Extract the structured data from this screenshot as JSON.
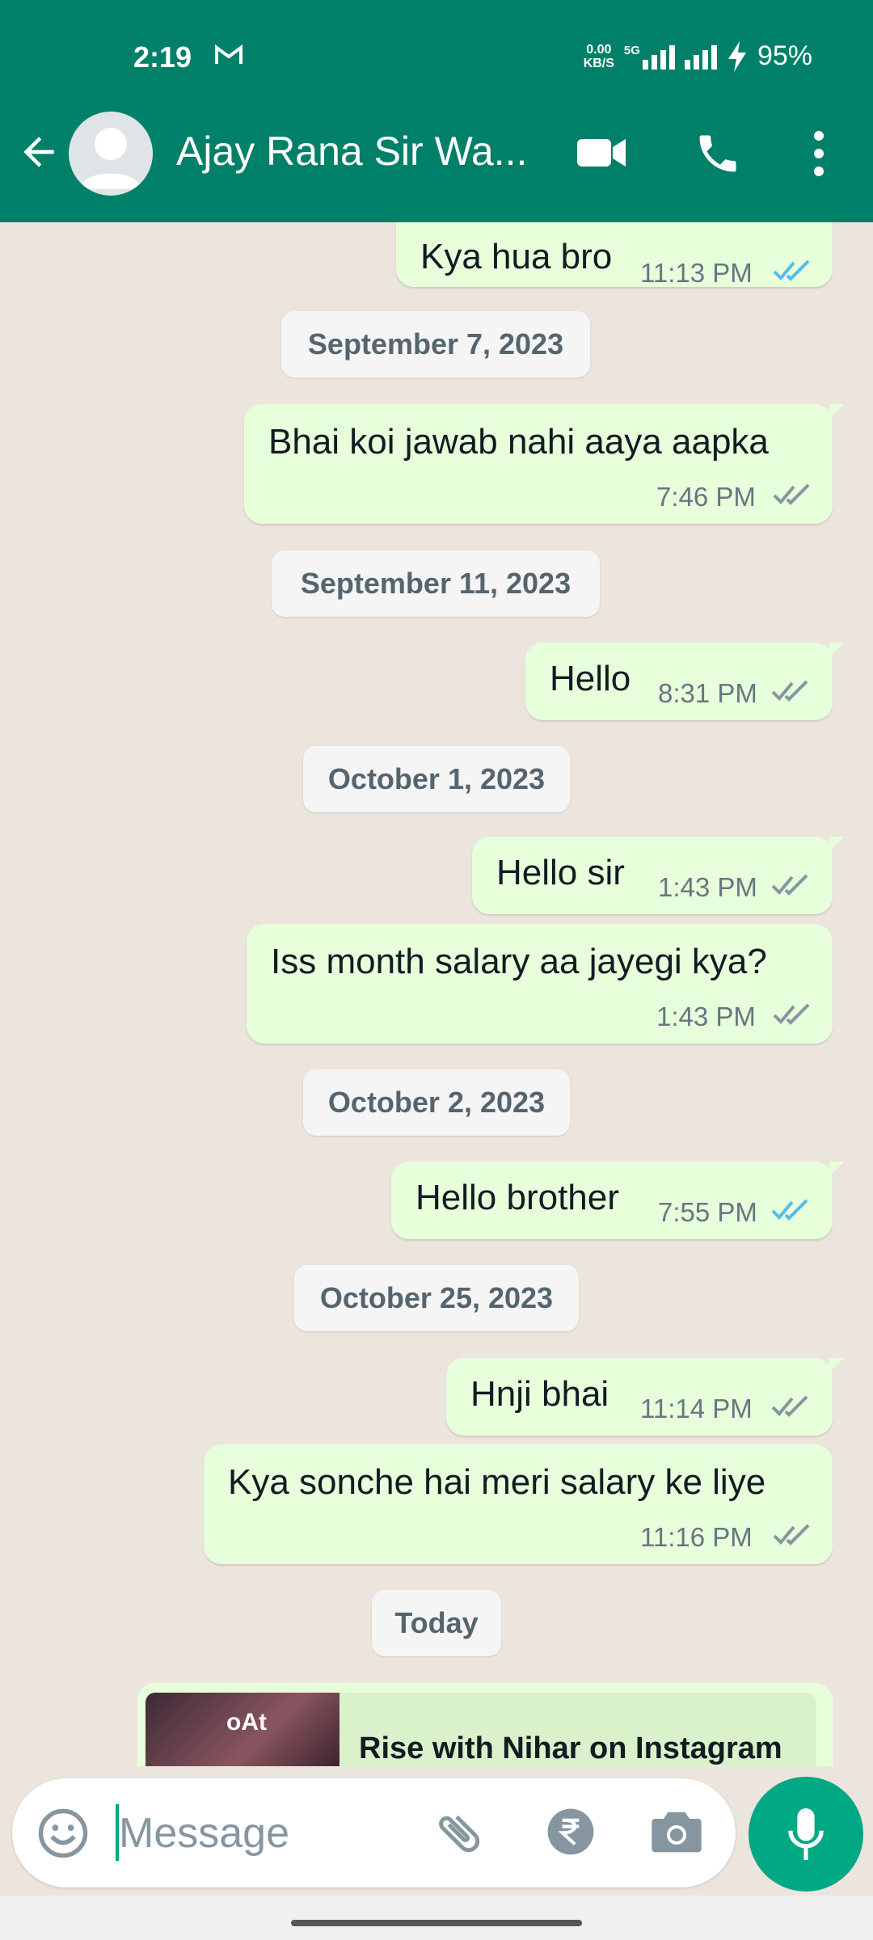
{
  "status_bar": {
    "time": "2:19",
    "net_speed_top": "0.00",
    "net_speed_bottom": "KB/S",
    "network": "5G",
    "battery": "95%"
  },
  "header": {
    "contact_name": "Ajay Rana Sir Wa...",
    "icons": [
      "back-arrow-icon",
      "avatar",
      "video-call-icon",
      "voice-call-icon",
      "more-vert-icon"
    ]
  },
  "messages": [
    {
      "text": "Kya hua bro",
      "time": "11:13 PM",
      "read": true
    },
    {
      "date": "September 7, 2023"
    },
    {
      "text": "Bhai koi jawab nahi aaya aapka",
      "time": "7:46 PM",
      "read": false
    },
    {
      "date": "September 11, 2023"
    },
    {
      "text": "Hello",
      "time": "8:31 PM",
      "read": false
    },
    {
      "date": "October 1, 2023"
    },
    {
      "text": "Hello sir",
      "time": "1:43 PM",
      "read": false
    },
    {
      "text": "Iss month salary aa jayegi kya?",
      "time": "1:43 PM",
      "read": false
    },
    {
      "date": "October 2, 2023"
    },
    {
      "text": "Hello brother",
      "time": "7:55 PM",
      "read": true
    },
    {
      "date": "October 25, 2023"
    },
    {
      "text": "Hnji bhai",
      "time": "11:14 PM",
      "read": false
    },
    {
      "text": "Kya sonche hai meri salary ke liye",
      "time": "11:16 PM",
      "read": false
    },
    {
      "date": "Today"
    }
  ],
  "link_preview": {
    "title": "Rise with Nihar on Instagram",
    "thumb_text": "oAt"
  },
  "composer": {
    "placeholder": "Message"
  },
  "colors": {
    "header": "#008069",
    "bubble_outgoing": "#e7ffdb",
    "chat_background": "#ece5dd",
    "read_ticks": "#53bdeb",
    "sent_ticks": "#8696a0",
    "accent": "#00a884"
  }
}
